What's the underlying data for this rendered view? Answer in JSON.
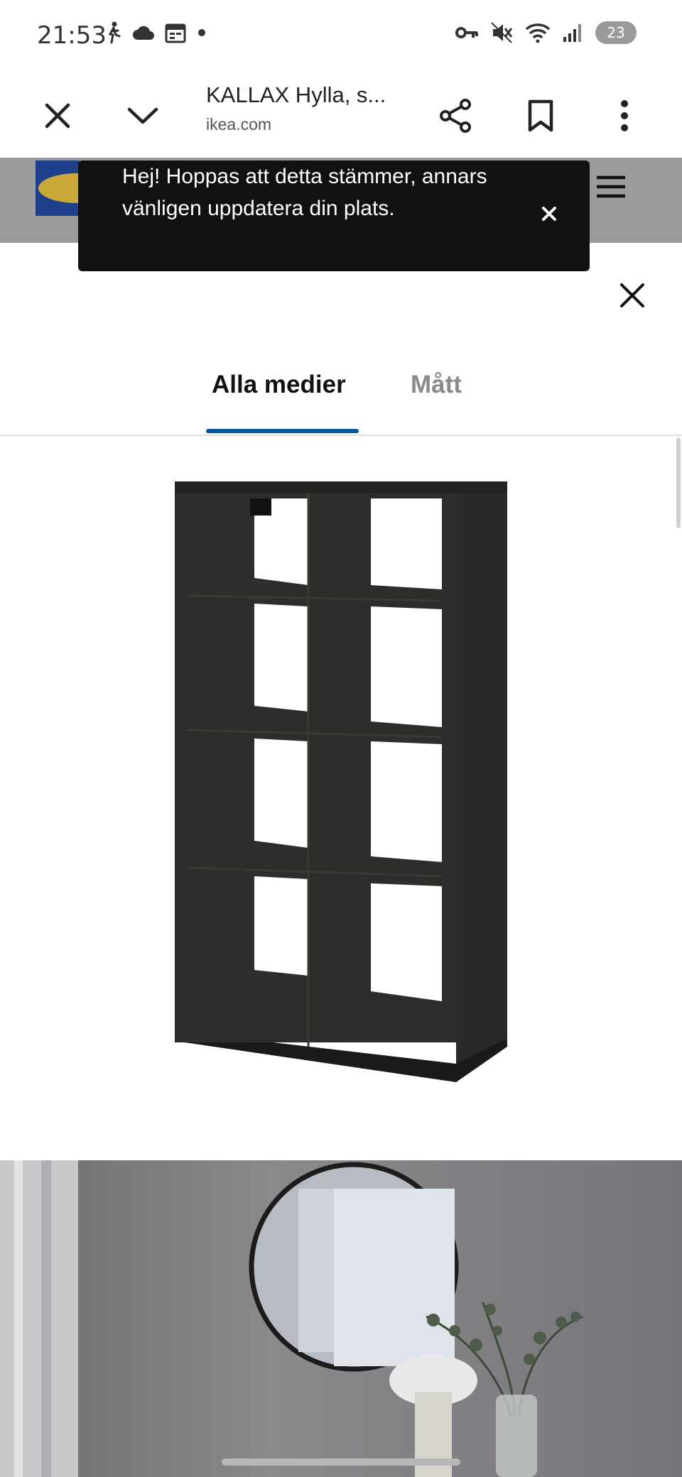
{
  "status_bar": {
    "time": "21:53",
    "battery": "23",
    "left_icons": [
      "walk-icon",
      "cloud-icon",
      "calendar-icon",
      "dot-icon"
    ],
    "right_icons": [
      "vpn-key-icon",
      "mute-icon",
      "wifi-icon",
      "signal-icon"
    ]
  },
  "browser": {
    "title": "KALLAX Hylla, s...",
    "url": "ikea.com",
    "icons": [
      "close-icon",
      "chevron-down-icon",
      "share-icon",
      "bookmark-icon",
      "more-vert-icon"
    ]
  },
  "toast": {
    "message": "Hej! Hoppas att detta stämmer, annars vänligen uppdatera din plats."
  },
  "media_viewer": {
    "tabs": [
      {
        "label": "Alla medier",
        "active": true
      },
      {
        "label": "Mått",
        "active": false
      }
    ]
  },
  "colors": {
    "accent": "#0058a3",
    "toast_bg": "#111111",
    "shelf": "#2e2d2b",
    "header_overlay": "#9b9b9b"
  }
}
